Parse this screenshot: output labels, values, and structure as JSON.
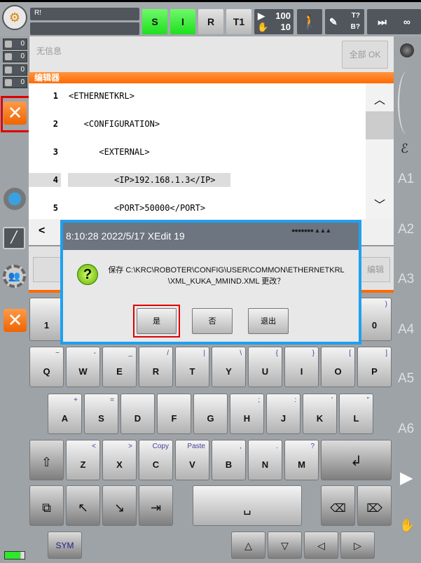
{
  "topbar": {
    "robot_name": "R!",
    "status2": "",
    "s": "S",
    "i": "I",
    "r": "R",
    "mode": "T1",
    "override_prog": "100",
    "override_jog": "10",
    "tool": "T?",
    "base": "B?",
    "infinity": "∞"
  },
  "messages": {
    "text": "无信息",
    "ok_all": "全部 OK",
    "counts": [
      "0",
      "0",
      "0",
      "0"
    ]
  },
  "editor": {
    "title": "编辑器",
    "lines": [
      {
        "n": "1",
        "code": "<ETHERNETKRL>"
      },
      {
        "n": "2",
        "code": "   <CONFIGURATION>"
      },
      {
        "n": "3",
        "code": "      <EXTERNAL>"
      },
      {
        "n": "4",
        "code": "         <IP>192.168.1.3</IP>"
      },
      {
        "n": "5",
        "code": "         <PORT>50000</PORT>"
      }
    ],
    "scroll_left": "<",
    "edit_button": "编辑"
  },
  "dialog": {
    "title": "8:10:28 2022/5/17 XEdit 19",
    "message_line1": "保存 C:\\KRC\\ROBOTER\\CONFIG\\USER\\COMMON\\ETHERNETKRL",
    "message_line2": "\\XML_KUKA_MMIND.XML 更改？",
    "yes": "是",
    "no": "否",
    "exit": "退出"
  },
  "keyboard": {
    "num": [
      {
        "k": "1",
        "s": ""
      },
      {
        "k": "0",
        "s": ")"
      }
    ],
    "row1": [
      {
        "k": "Q",
        "s": "~"
      },
      {
        "k": "W",
        "s": "-"
      },
      {
        "k": "E",
        "s": "_"
      },
      {
        "k": "R",
        "s": "/"
      },
      {
        "k": "T",
        "s": "|"
      },
      {
        "k": "Y",
        "s": "\\"
      },
      {
        "k": "U",
        "s": "{"
      },
      {
        "k": "I",
        "s": "}"
      },
      {
        "k": "O",
        "s": "["
      },
      {
        "k": "P",
        "s": "]"
      }
    ],
    "row2": [
      {
        "k": "A",
        "s": "+"
      },
      {
        "k": "S",
        "s": "="
      },
      {
        "k": "D",
        "s": ""
      },
      {
        "k": "F",
        "s": ""
      },
      {
        "k": "G",
        "s": ""
      },
      {
        "k": "H",
        "s": ";"
      },
      {
        "k": "J",
        "s": ":"
      },
      {
        "k": "K",
        "s": "'"
      },
      {
        "k": "L",
        "s": "\""
      }
    ],
    "row3": [
      {
        "k": "Z",
        "s": "<"
      },
      {
        "k": "X",
        "s": ">"
      },
      {
        "k": "C",
        "s": "Copy"
      },
      {
        "k": "V",
        "s": "Paste"
      },
      {
        "k": "B",
        "s": ","
      },
      {
        "k": "N",
        "s": "."
      },
      {
        "k": "M",
        "s": "?"
      }
    ],
    "shift": "⇧",
    "enter": "↲",
    "copy_icon": "⧉",
    "home": "↖",
    "end": "↘",
    "tab": "⇥",
    "space": "␣",
    "backspace": "⌫",
    "delete": "⌦",
    "sym": "SYM",
    "up": "△",
    "down": "▽",
    "left": "◁",
    "right": "▷"
  },
  "right_sidebar": {
    "axes": [
      "A1",
      "A2",
      "A3",
      "A4",
      "A5",
      "A6"
    ]
  },
  "colors": {
    "accent_orange": "#ff6a00",
    "dialog_border": "#1ea0f0",
    "status_green": "#2ee82a"
  }
}
